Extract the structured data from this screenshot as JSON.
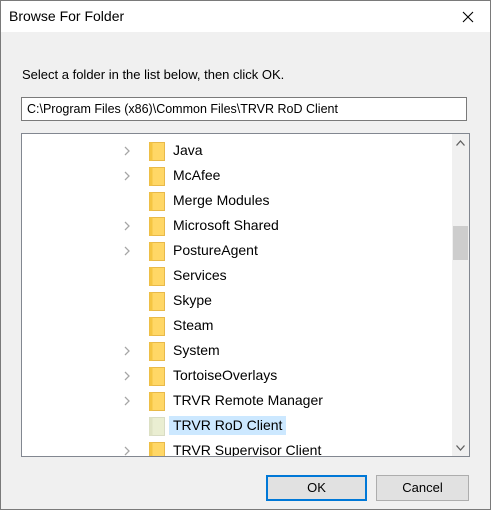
{
  "window": {
    "title": "Browse For Folder"
  },
  "instruction": "Select a folder in the list below, then click OK.",
  "path_field": {
    "value": "C:\\Program Files (x86)\\Common Files\\TRVR RoD Client"
  },
  "tree": {
    "items": [
      {
        "label": "Java",
        "expandable": true
      },
      {
        "label": "McAfee",
        "expandable": true
      },
      {
        "label": "Merge Modules",
        "expandable": false
      },
      {
        "label": "Microsoft Shared",
        "expandable": true
      },
      {
        "label": "PostureAgent",
        "expandable": true
      },
      {
        "label": "Services",
        "expandable": false
      },
      {
        "label": "Skype",
        "expandable": false
      },
      {
        "label": "Steam",
        "expandable": false
      },
      {
        "label": "System",
        "expandable": true
      },
      {
        "label": "TortoiseOverlays",
        "expandable": true
      },
      {
        "label": "TRVR Remote Manager",
        "expandable": true
      },
      {
        "label": "TRVR RoD Client",
        "expandable": false,
        "selected": true
      },
      {
        "label": "TRVR Supervisor Client",
        "expandable": true
      }
    ]
  },
  "buttons": {
    "ok": "OK",
    "cancel": "Cancel"
  },
  "colors": {
    "selection": "#cce8ff",
    "folder_fill": "#ffd766",
    "folder_selected_fill": "#eaeed2",
    "primary_border": "#0078d7"
  },
  "icons": {
    "close": "close-icon",
    "expand": "chevron-right-icon",
    "folder": "folder-icon",
    "scroll_up": "chevron-up-icon",
    "scroll_down": "chevron-down-icon"
  }
}
